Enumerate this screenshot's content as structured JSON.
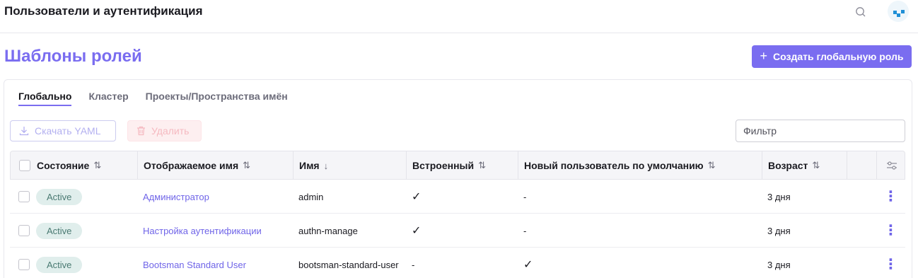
{
  "header": {
    "title": "Пользователи и аутентификация"
  },
  "page": {
    "title": "Шаблоны ролей",
    "create_button": "Создать глобальную роль",
    "create_plus": "+"
  },
  "tabs": [
    {
      "label": "Глобально",
      "active": true
    },
    {
      "label": "Кластер",
      "active": false
    },
    {
      "label": "Проекты/Пространства имён",
      "active": false
    }
  ],
  "toolbar": {
    "download_label": "Скачать YAML",
    "delete_label": "Удалить",
    "filter_placeholder": "Фильтр"
  },
  "table": {
    "columns": [
      {
        "label": "Состояние",
        "sort": "⇅"
      },
      {
        "label": "Отображаемое имя",
        "sort": "⇅"
      },
      {
        "label": "Имя",
        "sort": "↓"
      },
      {
        "label": "Встроенный",
        "sort": "⇅"
      },
      {
        "label": "Новый пользователь по умолчанию",
        "sort": "⇅"
      },
      {
        "label": "Возраст",
        "sort": "⇅"
      }
    ],
    "rows": [
      {
        "state": "Active",
        "display_name": "Администратор",
        "name": "admin",
        "builtin": "✓",
        "default_user": "-",
        "age": "3 дня"
      },
      {
        "state": "Active",
        "display_name": "Настройка аутентификации",
        "name": "authn-manage",
        "builtin": "✓",
        "default_user": "-",
        "age": "3 дня"
      },
      {
        "state": "Active",
        "display_name": "Bootsman Standard User",
        "name": "bootsman-standard-user",
        "builtin": "-",
        "default_user": "✓",
        "age": "3 дня"
      }
    ]
  },
  "colors": {
    "accent": "#7a6df0",
    "link": "#6f64e8",
    "badge_bg": "#e0eeec",
    "badge_text": "#4a7a72"
  }
}
